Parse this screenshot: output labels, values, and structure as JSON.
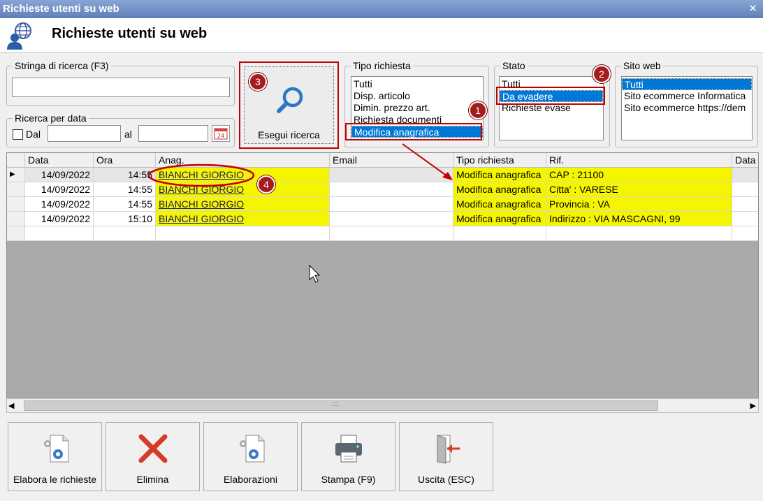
{
  "window": {
    "title": "Richieste utenti su web",
    "close_glyph": "✕"
  },
  "header": {
    "title": "Richieste utenti su web",
    "icon": "user-globe-icon"
  },
  "search": {
    "legend": "Stringa di ricerca (F3)",
    "value": ""
  },
  "date_search": {
    "legend": "Ricerca per data",
    "dal_label": "Dal",
    "dal_checked": false,
    "al_label": "al",
    "from_value": "",
    "to_value": "",
    "calendar_text": "24"
  },
  "execute_button": {
    "label": "Esegui ricerca",
    "badge": "3"
  },
  "request_type": {
    "legend": "Tipo richiesta",
    "options": [
      "Tutti",
      "Disp. articolo",
      "Dimin. prezzo art.",
      "Richiesta documenti",
      "Modifica anagrafica"
    ],
    "selected": "Modifica anagrafica",
    "badge": "1"
  },
  "status": {
    "legend": "Stato",
    "options": [
      "Tutti",
      "Da evadere",
      "Richieste evase"
    ],
    "selected": "Da evadere",
    "badge": "2"
  },
  "website": {
    "legend": "Sito web",
    "options": [
      "Tutti",
      "Sito ecommerce Informatica",
      "Sito ecommerce https://dem"
    ],
    "selected": "Tutti"
  },
  "grid": {
    "columns": [
      "Data",
      "Ora",
      "Anag.",
      "Email",
      "Tipo richiesta",
      "Rif.",
      "Data"
    ],
    "rows": [
      {
        "date": "14/09/2022",
        "time": "14:55",
        "anag": "BIANCHI GIORGIO",
        "email": "",
        "type": "Modifica anagrafica",
        "ref": "CAP : 21100"
      },
      {
        "date": "14/09/2022",
        "time": "14:55",
        "anag": "BIANCHI GIORGIO",
        "email": "",
        "type": "Modifica anagrafica",
        "ref": "Citta' : VARESE"
      },
      {
        "date": "14/09/2022",
        "time": "14:55",
        "anag": "BIANCHI GIORGIO",
        "email": "",
        "type": "Modifica anagrafica",
        "ref": "Provincia : VA"
      },
      {
        "date": "14/09/2022",
        "time": "15:10",
        "anag": "BIANCHI GIORGIO",
        "email": "",
        "type": "Modifica anagrafica",
        "ref": "Indirizzo : VIA MASCAGNI, 99"
      }
    ],
    "row_badge": "4",
    "current_row_glyph": "▶"
  },
  "scroll": {
    "left_glyph": "◀",
    "right_glyph": "▶",
    "grip": "::::::"
  },
  "buttons": [
    {
      "label": "Elabora le richieste",
      "icon": "gear-document-icon"
    },
    {
      "label": "Elimina",
      "icon": "red-x-icon"
    },
    {
      "label": "Elaborazioni",
      "icon": "gear-document-icon"
    },
    {
      "label": "Stampa (F9)",
      "icon": "printer-icon"
    },
    {
      "label": "Uscita (ESC)",
      "icon": "exit-door-icon"
    }
  ],
  "colors": {
    "selection": "#0078d7",
    "highlight": "#f5f500",
    "annotation_red": "#c00000",
    "badge": "#a51c1c",
    "titlebar": "#6f8fc4"
  }
}
